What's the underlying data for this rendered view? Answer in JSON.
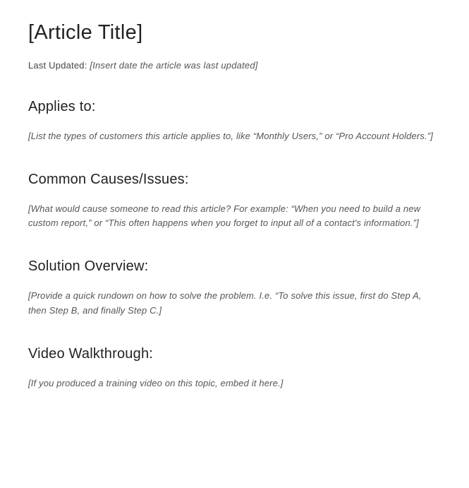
{
  "title": "[Article Title]",
  "last_updated": {
    "label": "Last Updated: ",
    "value": "[Insert date the article was last updated]"
  },
  "sections": {
    "applies_to": {
      "heading": "Applies to:",
      "body": "[List the types of customers this article applies to, like “Monthly Users,” or “Pro Account Holders.”]"
    },
    "common_causes": {
      "heading": "Common Causes/Issues:",
      "body": "[What would cause someone to read this article? For example: “When you need to build a new custom report,” or “This often happens when you forget to input all of a contact's information.”]"
    },
    "solution_overview": {
      "heading": "Solution Overview:",
      "body": "[Provide a quick rundown on how to solve the problem. I.e. “To solve this issue, first do Step A, then Step B, and finally Step C.]"
    },
    "video_walkthrough": {
      "heading": "Video Walkthrough:",
      "body": "[If you produced a training video on this topic, embed it here.]"
    }
  }
}
